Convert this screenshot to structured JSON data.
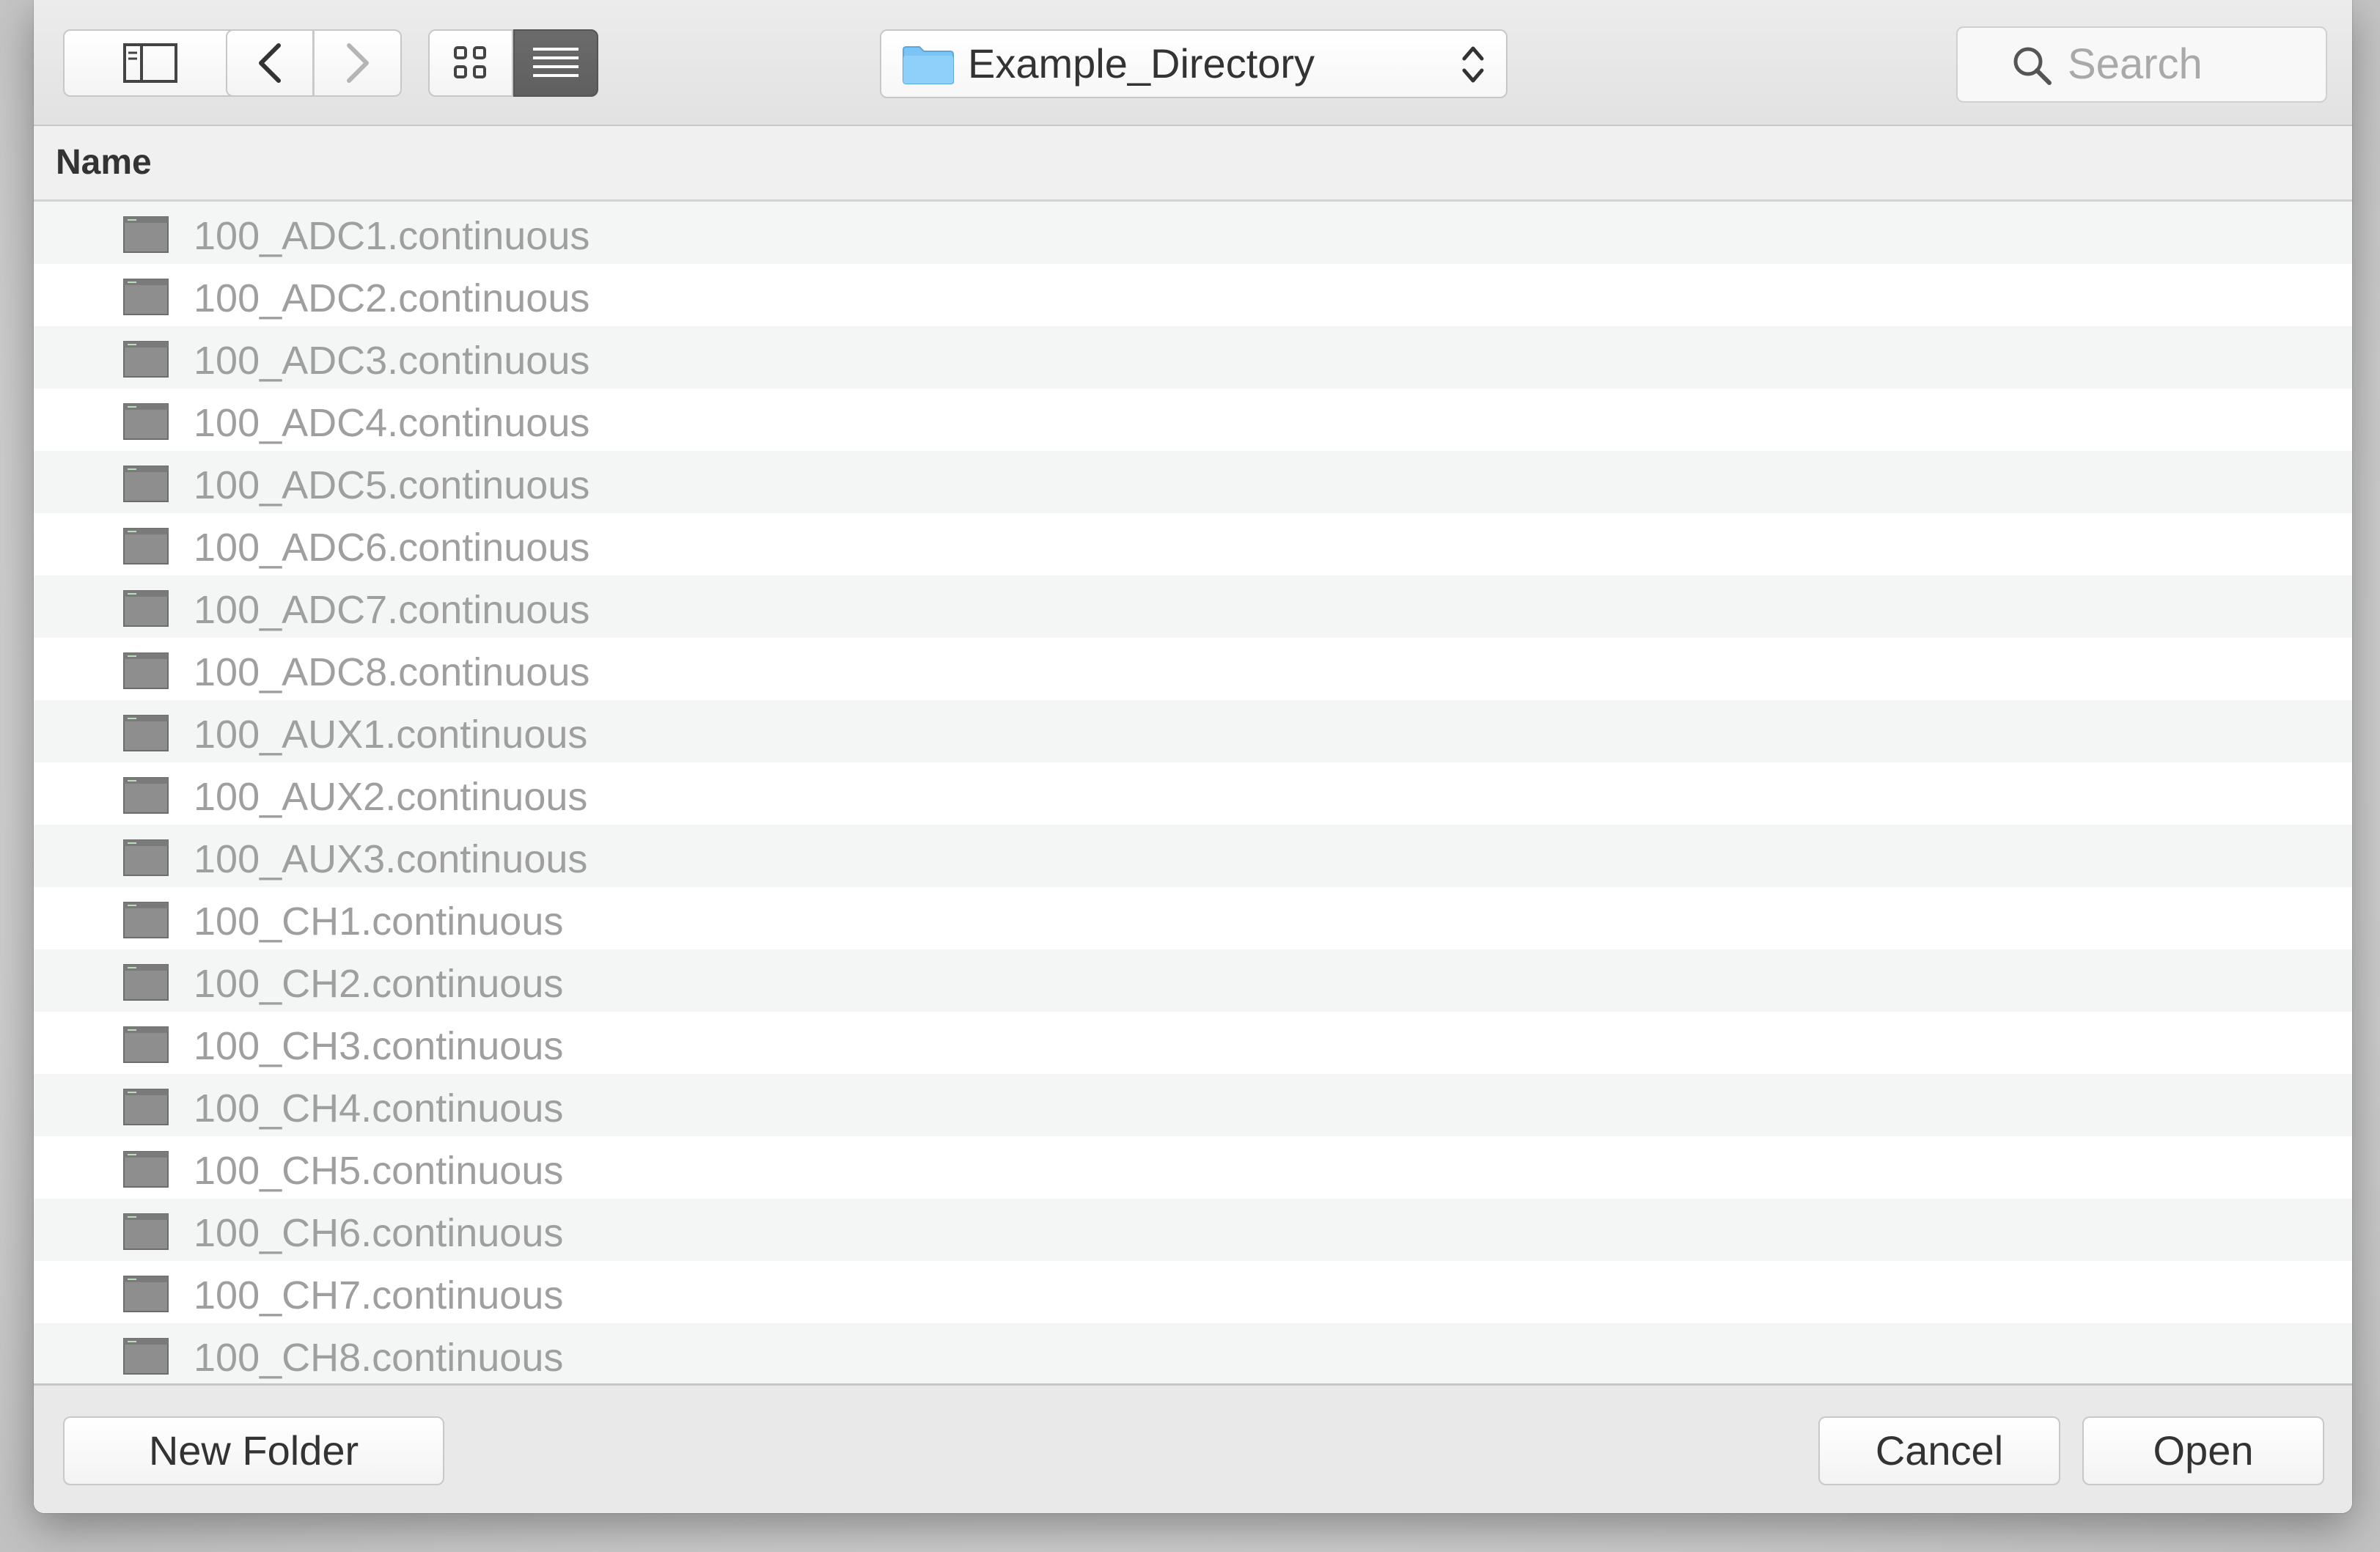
{
  "toolbar": {
    "path_popup": {
      "folder": "Example_Directory"
    },
    "search": {
      "placeholder": "Search"
    }
  },
  "table": {
    "column_header": "Name",
    "files": [
      "100_ADC1.continuous",
      "100_ADC2.continuous",
      "100_ADC3.continuous",
      "100_ADC4.continuous",
      "100_ADC5.continuous",
      "100_ADC6.continuous",
      "100_ADC7.continuous",
      "100_ADC8.continuous",
      "100_AUX1.continuous",
      "100_AUX2.continuous",
      "100_AUX3.continuous",
      "100_CH1.continuous",
      "100_CH2.continuous",
      "100_CH3.continuous",
      "100_CH4.continuous",
      "100_CH5.continuous",
      "100_CH6.continuous",
      "100_CH7.continuous",
      "100_CH8.continuous"
    ]
  },
  "bottom_bar": {
    "new_folder_label": "New Folder",
    "cancel_label": "Cancel",
    "open_label": "Open"
  },
  "icons": {
    "sidebar": "sidebar-toggle-icon",
    "back": "chevron-left-icon",
    "forward": "chevron-right-icon",
    "grid": "grid-view-icon",
    "list": "list-view-icon",
    "folder": "folder-icon",
    "updown": "up-down-arrows-icon",
    "search": "search-icon",
    "file": "document-icon"
  },
  "colors": {
    "folder_blue": "#7cc4f4",
    "active_button": "#636363",
    "file_text_disabled": "#9f9f9f"
  }
}
